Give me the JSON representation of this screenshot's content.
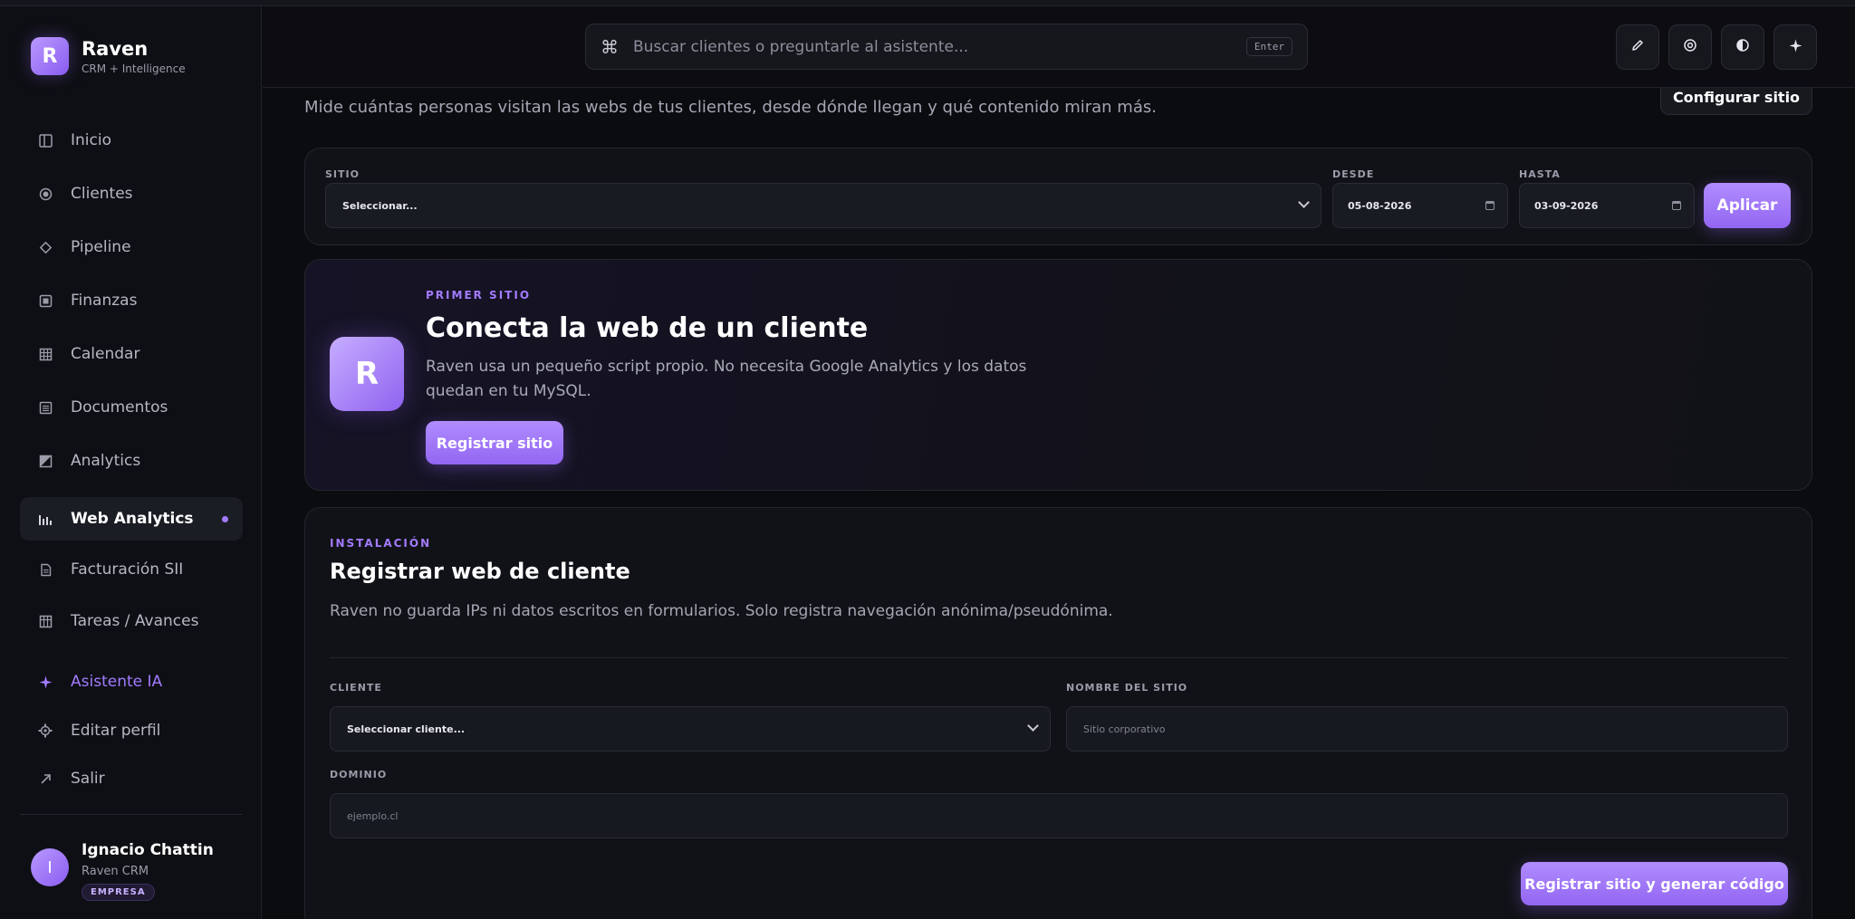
{
  "brand": {
    "logo_letter": "R",
    "name": "Raven",
    "subtitle": "CRM + Intelligence"
  },
  "sidebar": {
    "items": [
      {
        "label": "Inicio",
        "icon": "columns-icon"
      },
      {
        "label": "Clientes",
        "icon": "target-icon"
      },
      {
        "label": "Pipeline",
        "icon": "diamond-icon"
      },
      {
        "label": "Finanzas",
        "icon": "square-icon"
      },
      {
        "label": "Calendar",
        "icon": "grid-icon"
      },
      {
        "label": "Documentos",
        "icon": "list-icon"
      },
      {
        "label": "Analytics",
        "icon": "analytics-icon"
      },
      {
        "label": "Web Analytics",
        "icon": "bar-chart-icon",
        "active": true
      },
      {
        "label": "Facturación SII",
        "icon": "document-icon"
      },
      {
        "label": "Tareas / Avances",
        "icon": "table-icon"
      }
    ],
    "ai_item": {
      "label": "Asistente IA",
      "icon": "sparkle-icon"
    },
    "footer_items": [
      {
        "label": "Editar perfil",
        "icon": "gear-icon"
      },
      {
        "label": "Salir",
        "icon": "arrow-out-icon"
      }
    ],
    "user": {
      "initial": "I",
      "name": "Ignacio Chattin",
      "org": "Raven CRM",
      "badge": "EMPRESA"
    }
  },
  "header": {
    "search_placeholder": "Buscar clientes o preguntarle al asistente...",
    "search_shortcut": "Enter",
    "actions": [
      "edit-icon",
      "at-sign-icon",
      "contrast-icon",
      "sparkle-icon"
    ]
  },
  "page": {
    "subtitle": "Mide cuántas personas visitan las webs de tus clientes, desde dónde llegan y qué contenido miran más.",
    "config_button": "Configurar sitio"
  },
  "filters": {
    "site_label": "SITIO",
    "site_value": "Seleccionar...",
    "from_label": "DESDE",
    "from_value": "05-08-2026",
    "to_label": "HASTA",
    "to_value": "03-09-2026",
    "apply_button": "Aplicar"
  },
  "hero": {
    "logo_letter": "R",
    "eyebrow": "PRIMER SITIO",
    "title": "Conecta la web de un cliente",
    "description": "Raven usa un pequeño script propio. No necesita Google Analytics y los datos quedan en tu MySQL.",
    "button": "Registrar sitio"
  },
  "install": {
    "eyebrow": "INSTALACIÓN",
    "title": "Registrar web de cliente",
    "description": "Raven no guarda IPs ni datos escritos en formularios. Solo registra navegación anónima/pseudónima.",
    "client_label": "CLIENTE",
    "client_value": "Seleccionar cliente...",
    "site_name_label": "NOMBRE DEL SITIO",
    "site_name_placeholder": "Sitio corporativo",
    "domain_label": "DOMINIO",
    "domain_placeholder": "ejemplo.cl",
    "submit_button": "Registrar sitio y generar código"
  },
  "colors": {
    "accent": "#9366f2",
    "accent_light": "#b08cff",
    "background": "#0b0c10",
    "card": "#111217"
  }
}
